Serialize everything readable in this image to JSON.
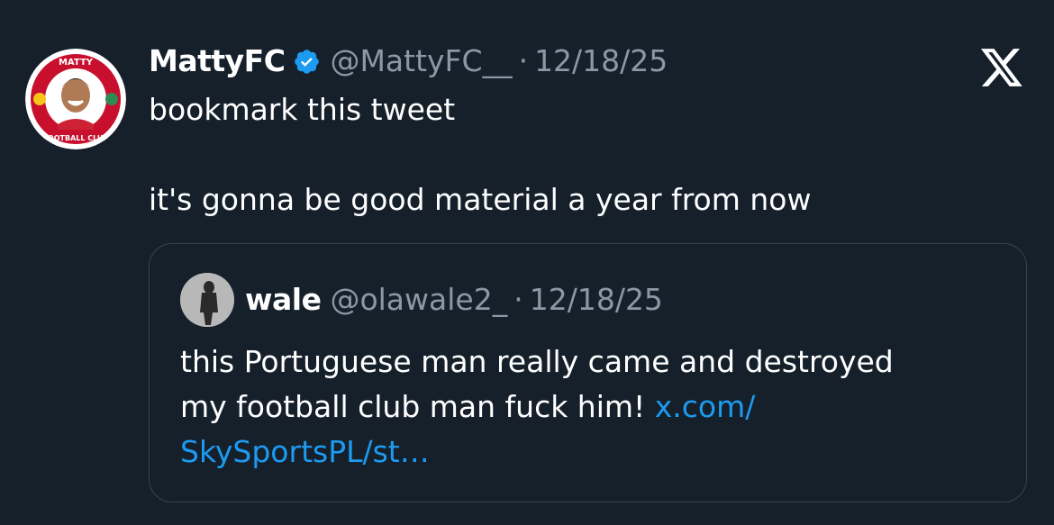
{
  "tweet": {
    "author_name": "MattyFC",
    "handle": "@MattyFC__",
    "separator": "·",
    "date": "12/18/25",
    "verified_icon": "verified-badge-icon",
    "avatar_text_top": "MATTY",
    "avatar_text_bottom": "FOOTBALL CLUB",
    "text_line1": "bookmark this tweet",
    "text_line2": "it's gonna be good material a year from now"
  },
  "quoted_tweet": {
    "author_name": "wale",
    "handle": "@olawale2_",
    "separator": "·",
    "date": "12/18/25",
    "text_line1": "this Portuguese man really came and destroyed",
    "text_line2_prefix": "my football club man fuck him! ",
    "link_part1": "x.com/",
    "link_part2": "SkySportsPL/st…"
  },
  "brand_icon": "x-logo-icon",
  "colors": {
    "background": "#15202b",
    "text": "#ffffff",
    "secondary": "#8b98a5",
    "link": "#1d9bf0",
    "border": "#38444d",
    "verified": "#1d9bf0"
  }
}
